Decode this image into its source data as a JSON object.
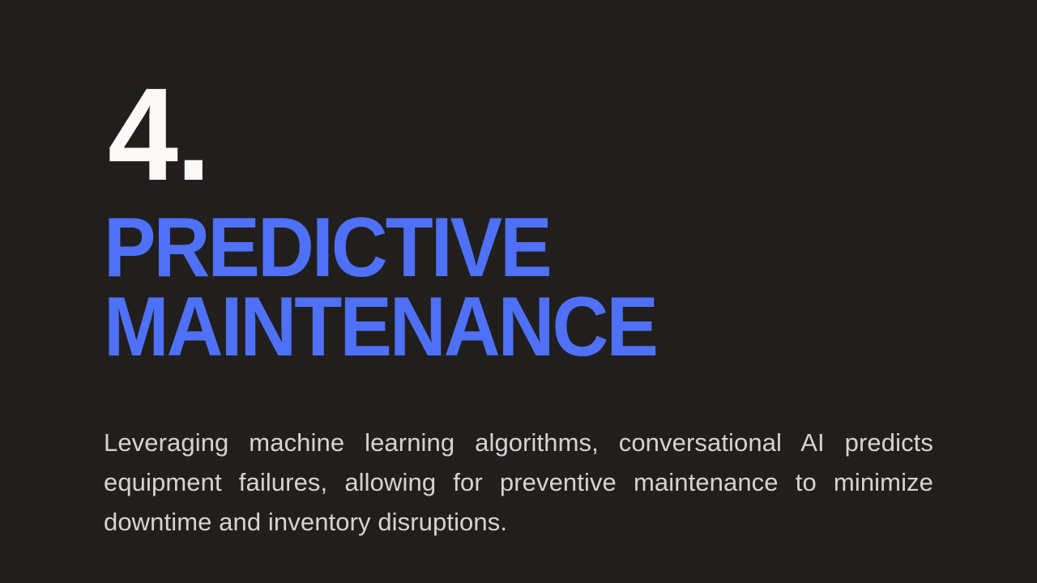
{
  "slide": {
    "background_color": "#211e1e",
    "step_number": "4.",
    "step_number_color": "#fbf9f7",
    "heading": {
      "color": "#4f71f8",
      "line1": "PREDICTIVE",
      "line2": "MAINTENANCE",
      "full_text": "PREDICTIVE MAINTENANCE"
    },
    "body": {
      "color": "#d6d3d1",
      "text": "Leveraging machine learning algorithms, conversational AI predicts equipment failures, allowing for preventive maintenance to minimize downtime and inventory disruptions."
    }
  }
}
